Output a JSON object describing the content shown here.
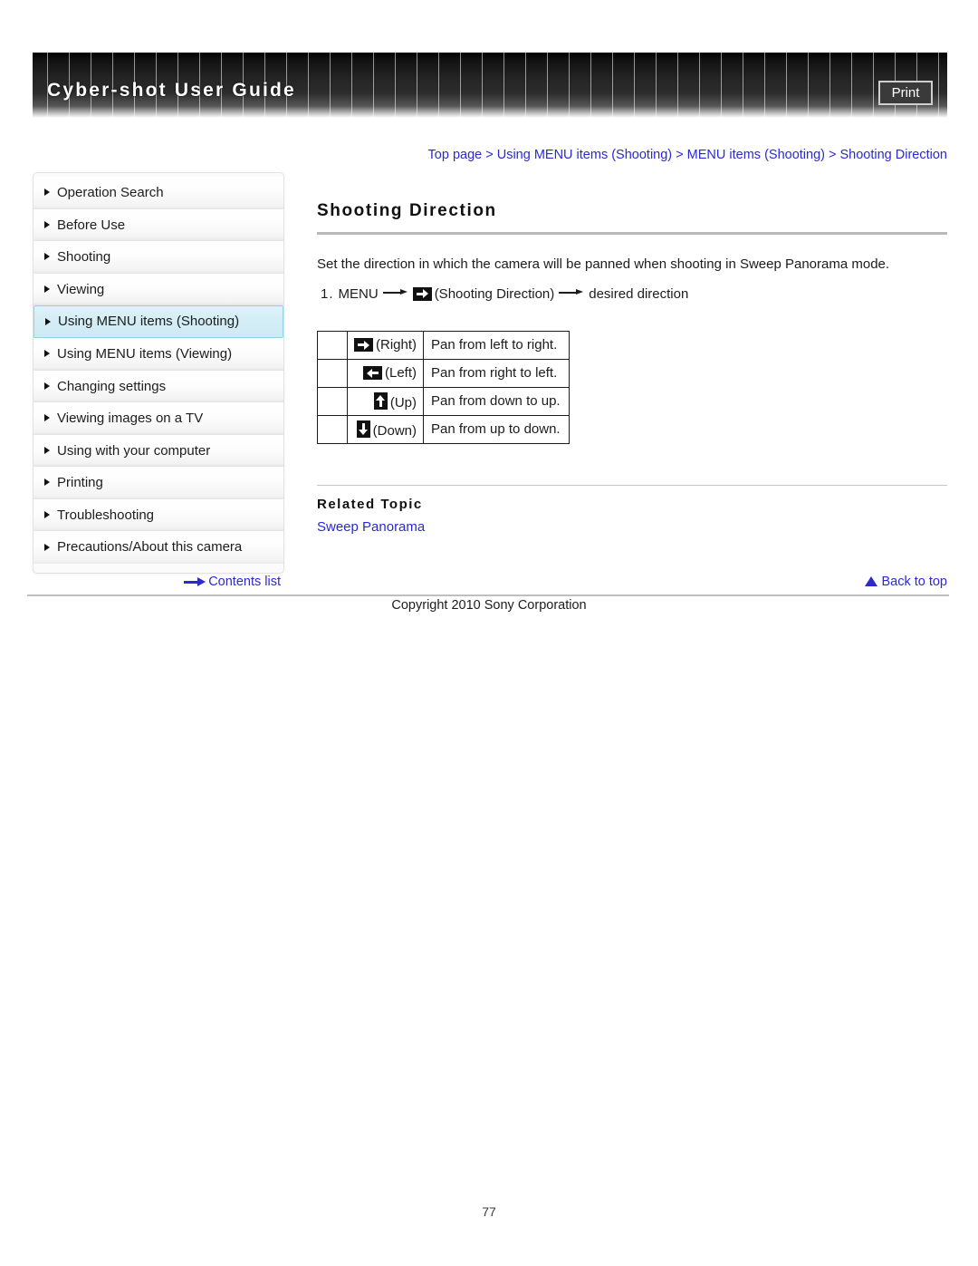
{
  "header": {
    "title": "Cyber-shot User Guide",
    "print_label": "Print"
  },
  "breadcrumb": {
    "items": [
      {
        "label": "Top page"
      },
      {
        "label": "Using MENU items (Shooting)"
      },
      {
        "label": "MENU items (Shooting)"
      },
      {
        "label": "Shooting Direction"
      }
    ],
    "separator": ">"
  },
  "sidebar": {
    "items": [
      {
        "label": "Operation Search",
        "selected": false
      },
      {
        "label": "Before Use",
        "selected": false
      },
      {
        "label": "Shooting",
        "selected": false
      },
      {
        "label": "Viewing",
        "selected": false
      },
      {
        "label": "Using MENU items (Shooting)",
        "selected": true
      },
      {
        "label": "Using MENU items (Viewing)",
        "selected": false
      },
      {
        "label": "Changing settings",
        "selected": false
      },
      {
        "label": "Viewing images on a TV",
        "selected": false
      },
      {
        "label": "Using with your computer",
        "selected": false
      },
      {
        "label": "Printing",
        "selected": false
      },
      {
        "label": "Troubleshooting",
        "selected": false
      },
      {
        "label": "Precautions/About this camera",
        "selected": false
      }
    ],
    "contents_list_label": "Contents list"
  },
  "main": {
    "title": "Shooting Direction",
    "intro": "Set the direction in which the camera will be panned when shooting in Sweep Panorama mode.",
    "step": {
      "number": "1.",
      "part1": "MENU",
      "part2": "(Shooting Direction)",
      "part3": "desired direction",
      "icon": "arrow-right-chip-icon"
    },
    "table": {
      "rows": [
        {
          "icon": "arrow-right-chip-icon",
          "label": "(Right)",
          "description": "Pan from left to right."
        },
        {
          "icon": "arrow-left-chip-icon",
          "label": "(Left)",
          "description": "Pan from right to left."
        },
        {
          "icon": "arrow-up-chip-icon",
          "label": "(Up)",
          "description": "Pan from down to up."
        },
        {
          "icon": "arrow-down-chip-icon",
          "label": "(Down)",
          "description": "Pan from up to down."
        }
      ]
    },
    "related": {
      "heading": "Related Topic",
      "link": "Sweep Panorama"
    },
    "back_to_top_label": "Back to top"
  },
  "footer": {
    "copyright": "Copyright 2010 Sony Corporation",
    "page_number": "77"
  },
  "colors": {
    "link": "#2a2ad0",
    "selected_bg": "#d3edf6",
    "selected_border": "#8fd3e8",
    "header_bg": "#111111"
  }
}
